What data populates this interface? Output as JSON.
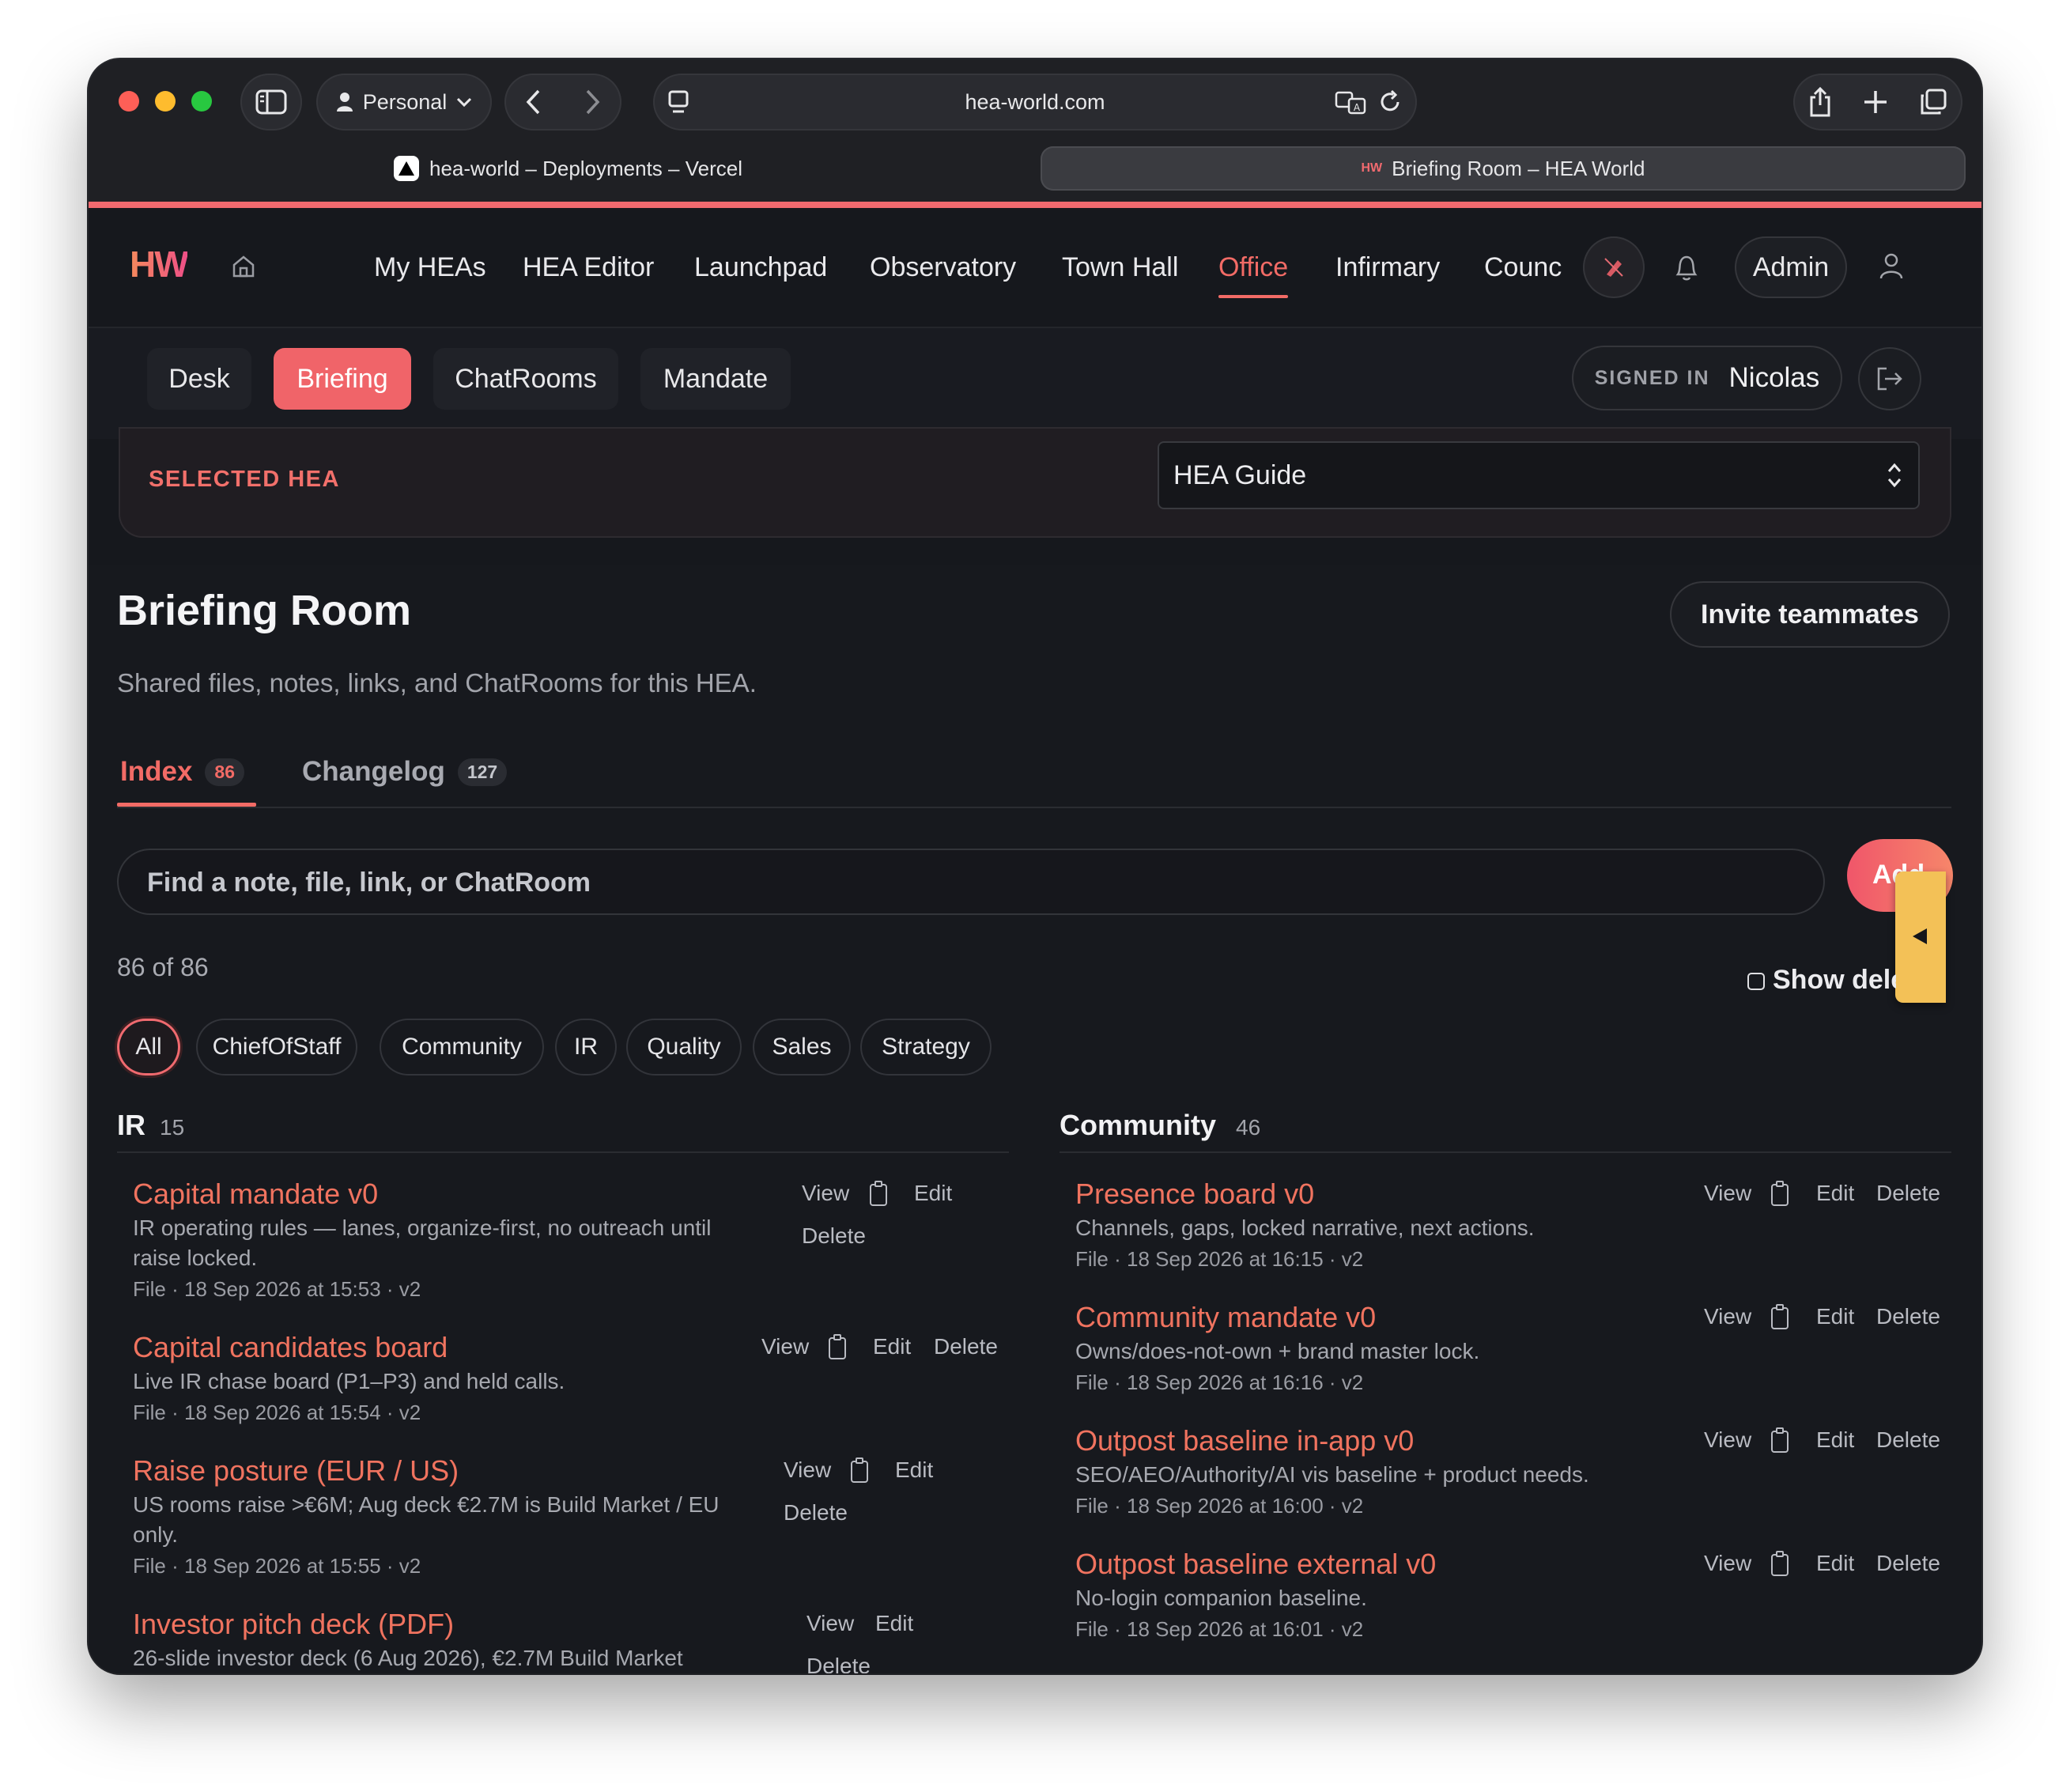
{
  "browser": {
    "profile_label": "Personal",
    "address": "hea-world.com",
    "tabs": [
      {
        "label": "hea-world – Deployments – Vercel"
      },
      {
        "label": "Briefing Room – HEA World"
      }
    ]
  },
  "app": {
    "logo": "HW",
    "nav": [
      "My HEAs",
      "HEA Editor",
      "Launchpad",
      "Observatory",
      "Town Hall",
      "Office",
      "Infirmary",
      "Counc"
    ],
    "active_nav": "Office",
    "admin_label": "Admin",
    "accent_color": "#f06a6f",
    "subtabs": [
      "Desk",
      "Briefing",
      "ChatRooms",
      "Mandate"
    ],
    "active_subtab": "Briefing",
    "signed_in_label": "SIGNED IN",
    "user_name": "Nicolas"
  },
  "selected_hea": {
    "label": "SELECTED HEA",
    "value": "HEA Guide"
  },
  "briefing": {
    "title": "Briefing Room",
    "subtitle": "Shared files, notes, links, and ChatRooms for this HEA.",
    "invite_label": "Invite teammates",
    "tabs": [
      {
        "label": "Index",
        "count": "86"
      },
      {
        "label": "Changelog",
        "count": "127"
      }
    ],
    "search_placeholder": "Find a note, file, link, or ChatRoom",
    "add_label": "Add",
    "result_count": "86 of 86",
    "show_deleted_label": "Show deleted",
    "filters": [
      "All",
      "ChiefOfStaff",
      "Community",
      "IR",
      "Quality",
      "Sales",
      "Strategy"
    ],
    "active_filter": "All",
    "actions": {
      "view": "View",
      "edit": "Edit",
      "delete": "Delete"
    }
  },
  "groups": [
    {
      "name": "IR",
      "count": "15",
      "items": [
        {
          "title": "Capital mandate v0",
          "desc": "IR operating rules — lanes, organize-first, no outreach until raise locked.",
          "meta": "File · 18 Sep 2026 at 15:53 · v2"
        },
        {
          "title": "Capital candidates board",
          "desc": "Live IR chase board (P1–P3) and held calls.",
          "meta": "File · 18 Sep 2026 at 15:54 · v2"
        },
        {
          "title": "Raise posture (EUR / US)",
          "desc": "US rooms raise >€6M; Aug deck €2.7M is Build Market / EU only.",
          "meta": "File · 18 Sep 2026 at 15:55 · v2"
        },
        {
          "title": "Investor pitch deck (PDF)",
          "desc": "26-slide investor deck (6 Aug 2026), €2.7M Build Market",
          "meta": ""
        }
      ]
    },
    {
      "name": "Community",
      "count": "46",
      "items": [
        {
          "title": "Presence board v0",
          "desc": "Channels, gaps, locked narrative, next actions.",
          "meta": "File · 18 Sep 2026 at 16:15 · v2"
        },
        {
          "title": "Community mandate v0",
          "desc": "Owns/does-not-own + brand master lock.",
          "meta": "File · 18 Sep 2026 at 16:16 · v2"
        },
        {
          "title": "Outpost baseline in-app v0",
          "desc": "SEO/AEO/Authority/AI vis baseline + product needs.",
          "meta": "File · 18 Sep 2026 at 16:00 · v2"
        },
        {
          "title": "Outpost baseline external v0",
          "desc": "No-login companion baseline.",
          "meta": "File · 18 Sep 2026 at 16:01 · v2"
        }
      ]
    }
  ]
}
